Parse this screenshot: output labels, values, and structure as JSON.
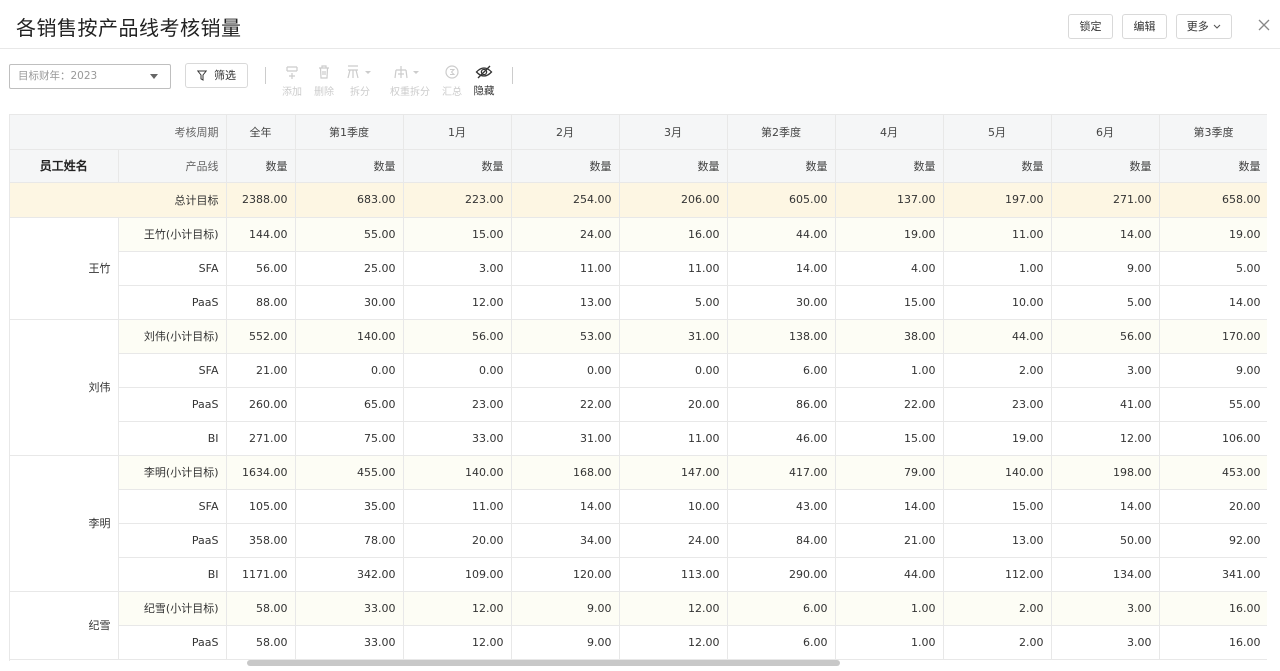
{
  "header": {
    "title": "各销售按产品线考核销量",
    "buttons": {
      "lock": "锁定",
      "edit": "编辑",
      "more": "更多"
    }
  },
  "toolbar": {
    "fiscal_year_select": "目标财年：2023",
    "filter_label": "筛选",
    "tools": [
      {
        "label": "添加",
        "icon": "add-row-icon",
        "enabled": false
      },
      {
        "label": "删除",
        "icon": "trash-icon",
        "enabled": false
      },
      {
        "label": "拆分",
        "icon": "split-icon",
        "enabled": false
      },
      {
        "label": "权重拆分",
        "icon": "weighted-split-icon",
        "enabled": false
      },
      {
        "label": "汇总",
        "icon": "sum-icon",
        "enabled": false
      },
      {
        "label": "隐藏",
        "icon": "eye-off-icon",
        "enabled": true
      }
    ]
  },
  "table": {
    "period_label": "考核周期",
    "employee_label": "员工姓名",
    "product_label": "产品线",
    "metric_label": "数量",
    "periods": [
      "全年",
      "第1季度",
      "1月",
      "2月",
      "3月",
      "第2季度",
      "4月",
      "5月",
      "6月",
      "第3季度"
    ],
    "total": {
      "label": "总计目标",
      "values": [
        "2388.00",
        "683.00",
        "223.00",
        "254.00",
        "206.00",
        "605.00",
        "137.00",
        "197.00",
        "271.00",
        "658.00"
      ]
    },
    "groups": [
      {
        "name": "王竹",
        "rows": [
          {
            "product": "王竹(小计目标)",
            "subtotal": true,
            "values": [
              "144.00",
              "55.00",
              "15.00",
              "24.00",
              "16.00",
              "44.00",
              "19.00",
              "11.00",
              "14.00",
              "19.00"
            ]
          },
          {
            "product": "SFA",
            "values": [
              "56.00",
              "25.00",
              "3.00",
              "11.00",
              "11.00",
              "14.00",
              "4.00",
              "1.00",
              "9.00",
              "5.00"
            ]
          },
          {
            "product": "PaaS",
            "values": [
              "88.00",
              "30.00",
              "12.00",
              "13.00",
              "5.00",
              "30.00",
              "15.00",
              "10.00",
              "5.00",
              "14.00"
            ]
          }
        ]
      },
      {
        "name": "刘伟",
        "rows": [
          {
            "product": "刘伟(小计目标)",
            "subtotal": true,
            "values": [
              "552.00",
              "140.00",
              "56.00",
              "53.00",
              "31.00",
              "138.00",
              "38.00",
              "44.00",
              "56.00",
              "170.00"
            ]
          },
          {
            "product": "SFA",
            "values": [
              "21.00",
              "0.00",
              "0.00",
              "0.00",
              "0.00",
              "6.00",
              "1.00",
              "2.00",
              "3.00",
              "9.00"
            ]
          },
          {
            "product": "PaaS",
            "values": [
              "260.00",
              "65.00",
              "23.00",
              "22.00",
              "20.00",
              "86.00",
              "22.00",
              "23.00",
              "41.00",
              "55.00"
            ]
          },
          {
            "product": "BI",
            "values": [
              "271.00",
              "75.00",
              "33.00",
              "31.00",
              "11.00",
              "46.00",
              "15.00",
              "19.00",
              "12.00",
              "106.00"
            ]
          }
        ]
      },
      {
        "name": "李明",
        "rows": [
          {
            "product": "李明(小计目标)",
            "subtotal": true,
            "values": [
              "1634.00",
              "455.00",
              "140.00",
              "168.00",
              "147.00",
              "417.00",
              "79.00",
              "140.00",
              "198.00",
              "453.00"
            ]
          },
          {
            "product": "SFA",
            "values": [
              "105.00",
              "35.00",
              "11.00",
              "14.00",
              "10.00",
              "43.00",
              "14.00",
              "15.00",
              "14.00",
              "20.00"
            ]
          },
          {
            "product": "PaaS",
            "values": [
              "358.00",
              "78.00",
              "20.00",
              "34.00",
              "24.00",
              "84.00",
              "21.00",
              "13.00",
              "50.00",
              "92.00"
            ]
          },
          {
            "product": "BI",
            "values": [
              "1171.00",
              "342.00",
              "109.00",
              "120.00",
              "113.00",
              "290.00",
              "44.00",
              "112.00",
              "134.00",
              "341.00"
            ]
          }
        ]
      },
      {
        "name": "纪雪",
        "rows": [
          {
            "product": "纪雪(小计目标)",
            "subtotal": true,
            "values": [
              "58.00",
              "33.00",
              "12.00",
              "9.00",
              "12.00",
              "6.00",
              "1.00",
              "2.00",
              "3.00",
              "16.00"
            ]
          },
          {
            "product": "PaaS",
            "values": [
              "58.00",
              "33.00",
              "12.00",
              "9.00",
              "12.00",
              "6.00",
              "1.00",
              "2.00",
              "3.00",
              "16.00"
            ]
          }
        ]
      }
    ]
  }
}
